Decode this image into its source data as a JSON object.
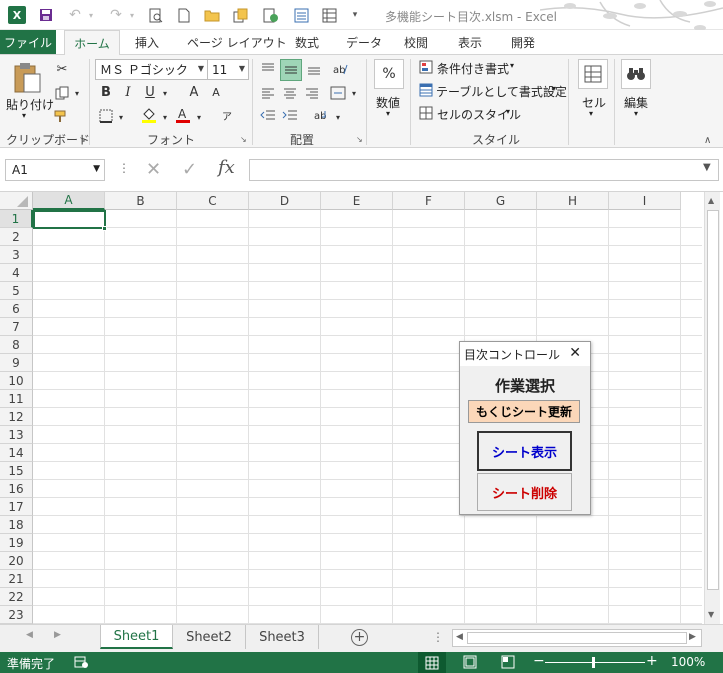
{
  "title": "多機能シート目次.xlsm - Excel",
  "tabs": {
    "file": "ファイル",
    "home": "ホーム",
    "insert": "挿入",
    "page_layout": "ページ レイアウト",
    "formulas": "数式",
    "data": "データ",
    "review": "校閲",
    "view": "表示",
    "developer": "開発"
  },
  "ribbon": {
    "clipboard": {
      "paste": "貼り付け",
      "label": "クリップボード"
    },
    "font": {
      "name": "ＭＳ Ｐゴシック",
      "size": "11",
      "bold": "B",
      "italic": "I",
      "underline": "U",
      "grow": "A",
      "shrink": "A",
      "label": "フォント"
    },
    "alignment": {
      "label": "配置"
    },
    "number": {
      "percent": "%",
      "label": "数値"
    },
    "styles": {
      "conditional": "条件付き書式",
      "table": "テーブルとして書式設定",
      "cell_styles": "セルのスタイル",
      "label": "スタイル"
    },
    "cells": {
      "label": "セル"
    },
    "editing": {
      "label": "編集"
    }
  },
  "formula_bar": {
    "name_box": "A1",
    "fx": "fx",
    "value": ""
  },
  "columns": [
    "A",
    "B",
    "C",
    "D",
    "E",
    "F",
    "G",
    "H",
    "I"
  ],
  "rows": [
    "1",
    "2",
    "3",
    "4",
    "5",
    "6",
    "7",
    "8",
    "9",
    "10",
    "11",
    "12",
    "13",
    "14",
    "15",
    "16",
    "17",
    "18",
    "19",
    "20",
    "21",
    "22",
    "23"
  ],
  "sheets": [
    "Sheet1",
    "Sheet2",
    "Sheet3"
  ],
  "status": {
    "ready": "準備完了",
    "zoom": "100%"
  },
  "dialog": {
    "title": "目次コントロール",
    "heading": "作業選択",
    "update_button": "もくじシート更新",
    "show_button": "シート表示",
    "delete_button": "シート削除"
  },
  "colors": {
    "accent": "#217346",
    "show_text": "#0000cc",
    "delete_text": "#cc0000",
    "update_bg": "#fbd7b9"
  }
}
